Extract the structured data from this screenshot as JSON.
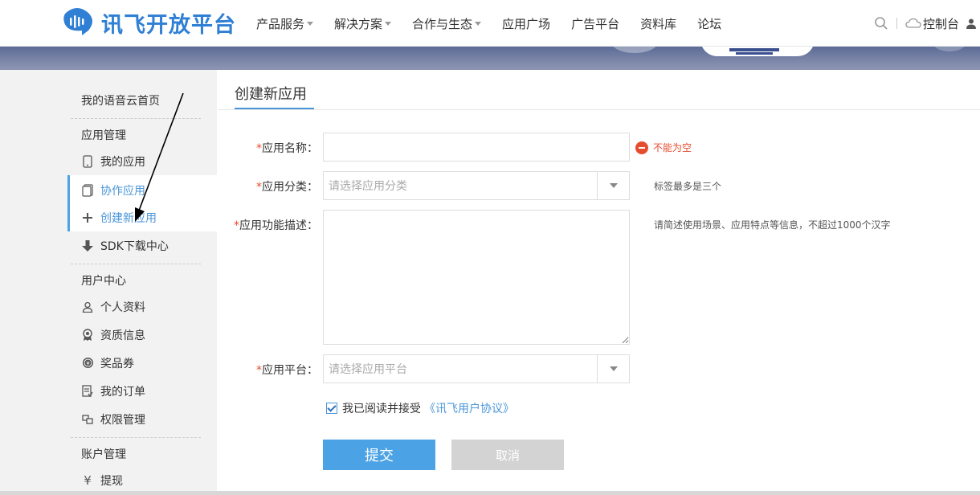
{
  "header": {
    "logo_text": "讯飞开放平台",
    "nav": [
      {
        "label": "产品服务",
        "dropdown": true
      },
      {
        "label": "解决方案",
        "dropdown": true
      },
      {
        "label": "合作与生态",
        "dropdown": true
      },
      {
        "label": "应用广场",
        "dropdown": false
      },
      {
        "label": "广告平台",
        "dropdown": false
      },
      {
        "label": "资料库",
        "dropdown": false
      },
      {
        "label": "论坛",
        "dropdown": false
      }
    ],
    "console_label": "控制台"
  },
  "sidebar": {
    "home": "我的语音云首页",
    "app_mgmt_heading": "应用管理",
    "my_apps": "我的应用",
    "collab_apps": "协作应用",
    "create_app": "创建新应用",
    "sdk_download": "SDK下载中心",
    "user_center_heading": "用户中心",
    "profile": "个人资料",
    "qualification": "资质信息",
    "coupons": "奖品券",
    "my_orders": "我的订单",
    "permissions": "权限管理",
    "account_heading": "账户管理",
    "withdraw": "提现"
  },
  "form": {
    "title": "创建新应用",
    "required_mark": "*",
    "name_label": "应用名称：",
    "name_value": "",
    "name_error": "不能为空",
    "category_label": "应用分类：",
    "category_placeholder": "请选择应用分类",
    "category_hint": "标签最多是三个",
    "desc_label": "应用功能描述：",
    "desc_hint": "请简述使用场景、应用特点等信息，不超过1000个汉字",
    "platform_label": "应用平台：",
    "platform_placeholder": "请选择应用平台",
    "agree_text": "我已阅读并接受",
    "agree_link": "《讯飞用户协议》",
    "agree_checked": true,
    "submit": "提交",
    "cancel": "取消"
  },
  "colors": {
    "accent": "#4ba3e6",
    "link": "#4b96d9",
    "error": "#e64c2e",
    "sidebar_bg": "#f2f2f2"
  }
}
